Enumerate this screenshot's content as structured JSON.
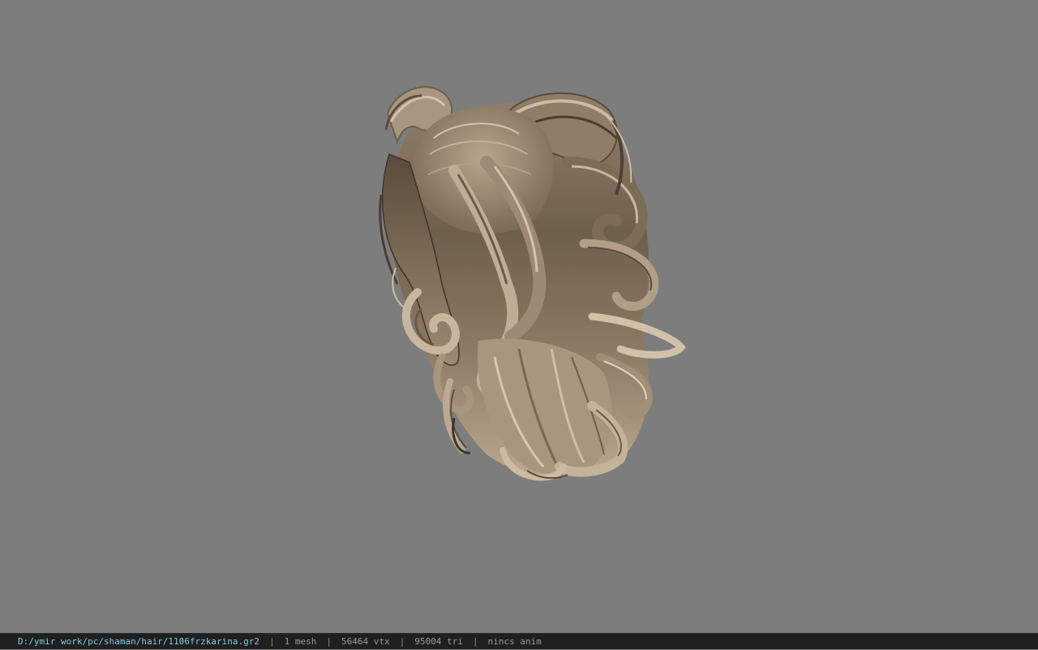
{
  "viewport": {
    "background_color": "#7d7d7d",
    "model_icon": "hair-mesh-render",
    "hair_colors": {
      "base": "#9c8a74",
      "shadow": "#5e5040",
      "dark": "#3f3428",
      "highlight": "#cdbca4",
      "tip": "#d8cbb6"
    }
  },
  "status_bar": {
    "file_path": "D:/ymir work/pc/shaman/hair/1106frzkarina.gr2",
    "separator": "|",
    "mesh_count": "1 mesh",
    "vertex_count": "56464 vtx",
    "triangle_count": "95004 tri",
    "anim_status": "nincs anim",
    "path_color": "#7fc9e6",
    "text_color": "#9a9a9a"
  }
}
